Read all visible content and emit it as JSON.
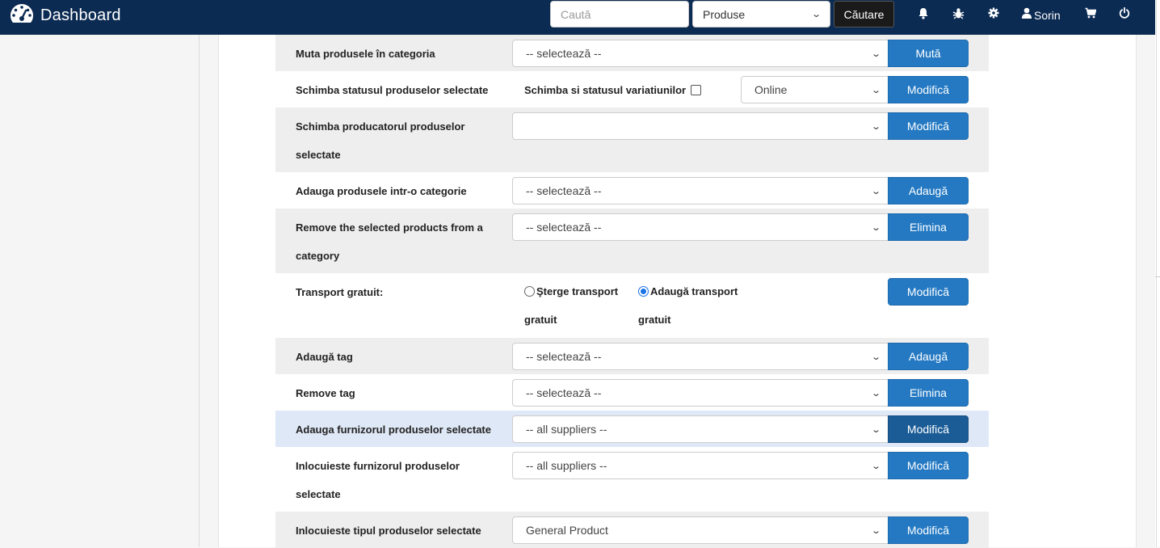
{
  "header": {
    "brand": "Dashboard",
    "search_placeholder": "Caută",
    "search_type": "Produse",
    "search_button": "Căutare",
    "user_name": "Sorin"
  },
  "form": {
    "rows": [
      {
        "label": "Muta produsele în categoria",
        "select": "-- selectează --",
        "button": "Mută"
      },
      {
        "label": "Schimba statusul produselor selectate",
        "extra": "Schimba si statusul variatiunilor",
        "select": "Online",
        "button": "Modifică"
      },
      {
        "label": "Schimba producatorul produselor selectate",
        "select": "",
        "button": "Modifică"
      },
      {
        "label": "Adauga produsele intr-o categorie",
        "select": "-- selectează --",
        "button": "Adaugă"
      },
      {
        "label": "Remove the selected products from a category",
        "select": "-- selectează --",
        "button": "Elimina"
      },
      {
        "label": "Transport gratuit:",
        "radio_remove": "Şterge transport gratuit",
        "radio_add": "Adaugă transport gratuit",
        "button": "Modifică"
      },
      {
        "label": "Adaugă tag",
        "select": "-- selectează --",
        "button": "Adaugă"
      },
      {
        "label": "Remove tag",
        "select": "-- selectează --",
        "button": "Elimina"
      },
      {
        "label": "Adauga furnizorul produselor selectate",
        "select": "-- all suppliers --",
        "button": "Modifică"
      },
      {
        "label": "Inlocuieste furnizorul produselor selectate",
        "select": "-- all suppliers --",
        "button": "Modifică"
      },
      {
        "label": "Inlocuieste tipul produselor selectate",
        "select": "General Product",
        "button": "Modifică"
      }
    ]
  },
  "colors": {
    "navbar": "#0c2b53",
    "button": "#2479c2",
    "row_shade": "#eeeeee",
    "row_hover": "#dfe8f6"
  }
}
